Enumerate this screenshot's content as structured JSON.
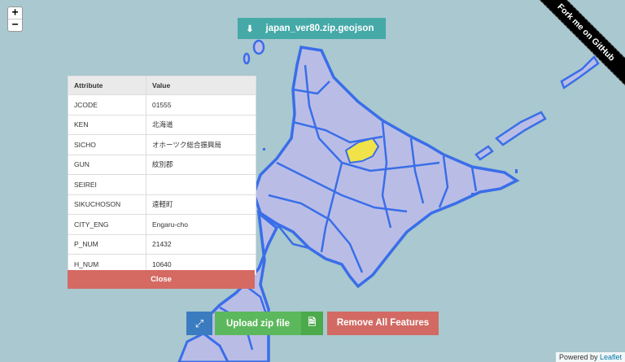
{
  "zoom": {
    "in": "+",
    "out": "−"
  },
  "download": {
    "label": "japan_ver80.zip.geojson",
    "icon": "download-icon"
  },
  "ribbon": {
    "label": "Fork me on GitHub"
  },
  "table": {
    "headers": {
      "attribute": "Attribute",
      "value": "Value"
    },
    "rows": [
      {
        "k": "JCODE",
        "v": "01555"
      },
      {
        "k": "KEN",
        "v": "北海道"
      },
      {
        "k": "SICHO",
        "v": "オホーツク総合振興局"
      },
      {
        "k": "GUN",
        "v": "紋別郡"
      },
      {
        "k": "SEIREI",
        "v": ""
      },
      {
        "k": "SIKUCHOSON",
        "v": "遠軽町"
      },
      {
        "k": "CITY_ENG",
        "v": "Engaru-cho"
      },
      {
        "k": "P_NUM",
        "v": "21432"
      },
      {
        "k": "H_NUM",
        "v": "10640"
      }
    ]
  },
  "close_label": "Close",
  "fit_icon": "expand-icon",
  "upload": {
    "label": "Upload zip file",
    "icon": "file-icon"
  },
  "remove_label": "Remove All Features",
  "attribution": {
    "prefix": "Powered by ",
    "link": "Leaflet"
  },
  "colors": {
    "sea": "#a9c8cf",
    "land": "#b9bde6",
    "border": "#3a6ee8",
    "selected": "#f0e34a"
  }
}
